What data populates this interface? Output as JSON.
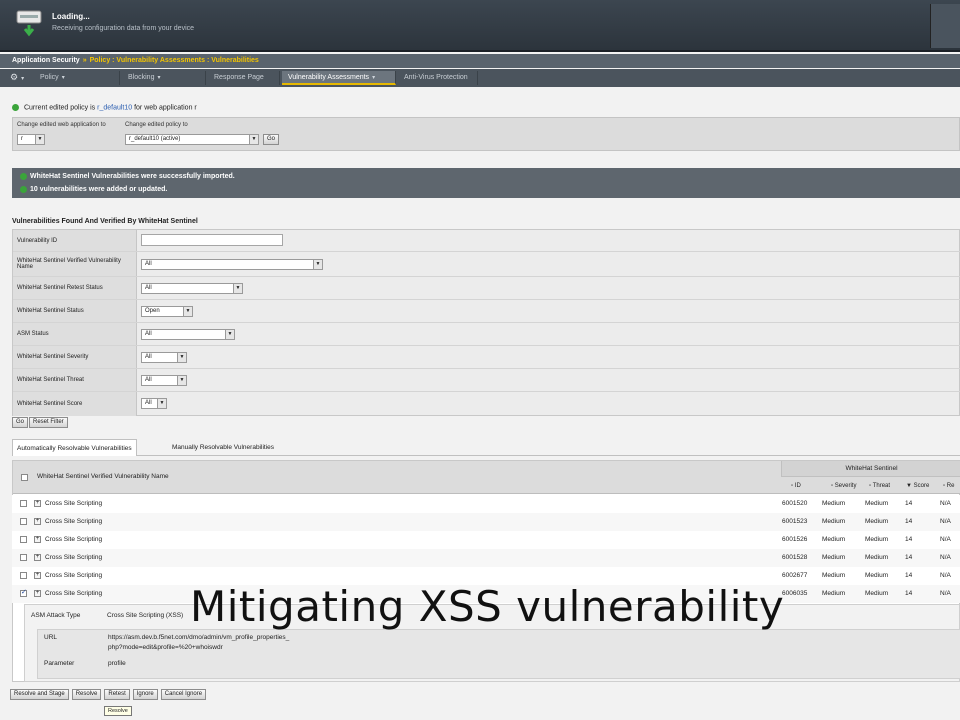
{
  "banner": {
    "title": "Loading...",
    "subtitle": "Receiving configuration data from your device"
  },
  "breadcrumb": {
    "root": "Application Security",
    "path": "Policy : Vulnerability Assessments : Vulnerabilities"
  },
  "nav": {
    "tabs": [
      "Policy",
      "Blocking",
      "Response Page",
      "Vulnerability Assessments",
      "Anti-Virus Protection"
    ],
    "active_index": 3
  },
  "policy": {
    "prefix": "Current edited policy is",
    "policy_name": "r_default10",
    "suffix": "for web application r",
    "change_app_label": "Change edited web application to",
    "change_app_value": "r",
    "change_policy_label": "Change edited policy to",
    "change_policy_value": "r_default10 (active)",
    "go_label": "Go"
  },
  "messages": [
    "WhiteHat Sentinel Vulnerabilities were successfully imported.",
    "10 vulnerabilities were added or updated."
  ],
  "filter": {
    "title": "Vulnerabilities Found And Verified By WhiteHat Sentinel",
    "rows": [
      {
        "label": "Vulnerability ID",
        "value": ""
      },
      {
        "label": "WhiteHat Sentinel Verified Vulnerability Name",
        "value": "All"
      },
      {
        "label": "WhiteHat Sentinel Retest Status",
        "value": "All"
      },
      {
        "label": "WhiteHat Sentinel Status",
        "value": "Open"
      },
      {
        "label": "ASM Status",
        "value": "All"
      },
      {
        "label": "WhiteHat Sentinel Severity",
        "value": "All"
      },
      {
        "label": "WhiteHat Sentinel Threat",
        "value": "All"
      },
      {
        "label": "WhiteHat Sentinel Score",
        "value": "All"
      }
    ],
    "go_label": "Go",
    "reset_label": "Reset Filter"
  },
  "tabs": {
    "auto": "Automatically Resolvable Vulnerabilities",
    "manual": "Manually Resolvable Vulnerabilities"
  },
  "table": {
    "name_header": "WhiteHat Sentinel Verified Vulnerability Name",
    "group_header": "WhiteHat Sentinel",
    "sub_headers": [
      "ID",
      "Severity",
      "Threat",
      "Score",
      "Re"
    ],
    "rows": [
      {
        "name": "Cross Site Scripting",
        "id": "6001520",
        "severity": "Medium",
        "threat": "Medium",
        "score": "14",
        "retest": "N/A",
        "checked": false
      },
      {
        "name": "Cross Site Scripting",
        "id": "6001523",
        "severity": "Medium",
        "threat": "Medium",
        "score": "14",
        "retest": "N/A",
        "checked": false
      },
      {
        "name": "Cross Site Scripting",
        "id": "6001526",
        "severity": "Medium",
        "threat": "Medium",
        "score": "14",
        "retest": "N/A",
        "checked": false
      },
      {
        "name": "Cross Site Scripting",
        "id": "6001528",
        "severity": "Medium",
        "threat": "Medium",
        "score": "14",
        "retest": "N/A",
        "checked": false
      },
      {
        "name": "Cross Site Scripting",
        "id": "6002677",
        "severity": "Medium",
        "threat": "Medium",
        "score": "14",
        "retest": "N/A",
        "checked": false
      },
      {
        "name": "Cross Site Scripting",
        "id": "6006035",
        "severity": "Medium",
        "threat": "Medium",
        "score": "14",
        "retest": "N/A",
        "checked": true
      }
    ]
  },
  "detail": {
    "attack_type_label": "ASM Attack Type",
    "attack_type_value": "Cross Site Scripting (XSS)",
    "url_label": "URL",
    "url_value_1": "https://asm.dev.b.f5net.com/dmo/admin/vm_profile_properties_",
    "url_value_2": "php?mode=edit&profile=%20+whoiswdr",
    "param_label": "Parameter",
    "param_value": "profile"
  },
  "actions": [
    "Resolve and Stage",
    "Resolve",
    "Retest",
    "Ignore",
    "Cancel Ignore"
  ],
  "tooltip": "Resolve",
  "caption": "Mitigating XSS vulnerability"
}
